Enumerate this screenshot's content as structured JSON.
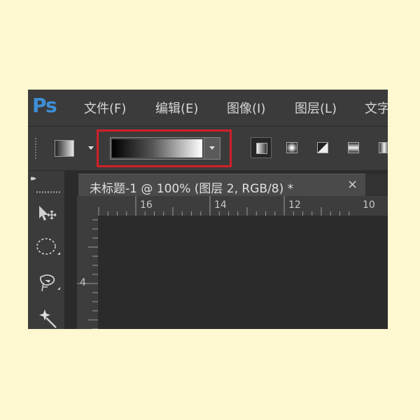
{
  "app": {
    "logo": "Ps"
  },
  "menu": {
    "items": [
      {
        "label": "文件(F)"
      },
      {
        "label": "编辑(E)"
      },
      {
        "label": "图像(I)"
      },
      {
        "label": "图层(L)"
      },
      {
        "label": "文字"
      }
    ]
  },
  "options_bar": {
    "gradient_picker": {
      "preview_colors": [
        "#000000",
        "#ffffff"
      ],
      "highlight_color": "#d0202a"
    },
    "gradient_types": [
      {
        "name": "linear",
        "selected": true
      },
      {
        "name": "radial",
        "selected": false
      },
      {
        "name": "angle",
        "selected": false
      },
      {
        "name": "reflected",
        "selected": false
      },
      {
        "name": "diamond",
        "selected": false
      }
    ]
  },
  "toolbar": {
    "collapse_glyph": "▸▸",
    "tools": [
      {
        "icon": "move-icon"
      },
      {
        "icon": "elliptical-marquee-icon"
      },
      {
        "icon": "lasso-icon"
      },
      {
        "icon": "magic-wand-icon"
      }
    ]
  },
  "document": {
    "tab_title": "未标题-1 @ 100% (图层 2, RGB/8) *",
    "close_glyph": "×"
  },
  "rulers": {
    "top_labels": [
      "16",
      "14",
      "12",
      "10"
    ],
    "left_labels": [
      "4"
    ]
  },
  "colors": {
    "page_background": "#fdf8cf",
    "ui_panel": "#3b3b3b",
    "canvas": "#2b2b2b",
    "ps_blue": "#3d8fd6"
  }
}
